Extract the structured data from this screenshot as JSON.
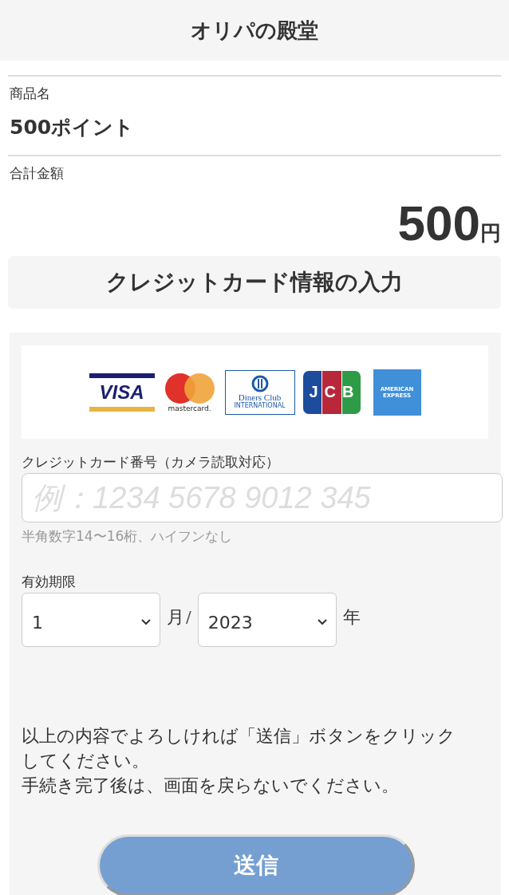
{
  "header": {
    "title": "オリパの殿堂"
  },
  "product": {
    "label": "商品名",
    "value": "500ポイント"
  },
  "total": {
    "label": "合計金額",
    "amount": "500",
    "unit": "円"
  },
  "section_title": "クレジットカード情報の入力",
  "card_logos": [
    {
      "kind": "visa",
      "texts": [
        "VISA"
      ]
    },
    {
      "kind": "mastercard",
      "texts": [
        "mastercard."
      ]
    },
    {
      "kind": "diners",
      "texts": [
        "Diners Club",
        "INTERNATIONAL"
      ]
    },
    {
      "kind": "jcb",
      "texts": [
        "JCB"
      ]
    },
    {
      "kind": "amex",
      "texts": [
        "AMERICAN",
        "EXPRESS"
      ]
    }
  ],
  "card_number": {
    "label": "クレジットカード番号（カメラ読取対応）",
    "placeholder": "例：1234 5678 9012 345",
    "hint": "半角数字14〜16桁、ハイフンなし"
  },
  "expiry": {
    "label": "有効期限",
    "month": "1",
    "month_unit": "月",
    "separator": "/",
    "year": "2023",
    "year_unit": "年"
  },
  "notice": [
    "以上の内容でよろしければ「送信」ボタンをクリックしてください。",
    "手続き完了後は、画面を戻らないでください。"
  ],
  "submit": {
    "label": "送信"
  }
}
